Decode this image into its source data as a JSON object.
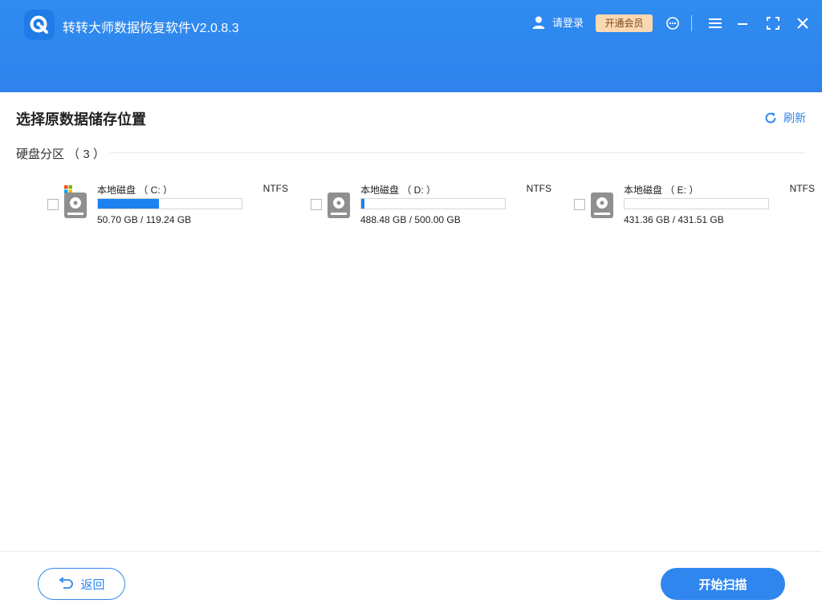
{
  "app": {
    "title": "转转大师数据恢复软件V2.0.8.3"
  },
  "header": {
    "login_label": "请登录",
    "vip_label": "开通会员"
  },
  "main": {
    "title": "选择原数据储存位置",
    "refresh_label": "刷新",
    "section_label": "硬盘分区 （ 3 ）"
  },
  "disks": [
    {
      "name": "本地磁盘 （ C: ）",
      "fs": "NTFS",
      "size": "50.70 GB / 119.24 GB",
      "used_fraction": 0.425,
      "system_drive": true
    },
    {
      "name": "本地磁盘 （ D: ）",
      "fs": "NTFS",
      "size": "488.48 GB / 500.00 GB",
      "used_fraction": 0.023,
      "system_drive": false
    },
    {
      "name": "本地磁盘 （ E: ）",
      "fs": "NTFS",
      "size": "431.36 GB / 431.51 GB",
      "used_fraction": 0.0,
      "system_drive": false
    }
  ],
  "footer": {
    "back_label": "返回",
    "scan_label": "开始扫描"
  },
  "colors": {
    "header_blue": "#2f86ee",
    "accent": "#2f86ee",
    "bar_fill": "#1b82f0",
    "vip_bg": "#fad8b1"
  },
  "icons": [
    "app-logo-icon",
    "user-icon",
    "support-icon",
    "menu-icon",
    "minimize-icon",
    "maximize-icon",
    "close-icon",
    "refresh-icon",
    "hard-disk-icon",
    "windows-icon",
    "back-arrow-icon"
  ]
}
